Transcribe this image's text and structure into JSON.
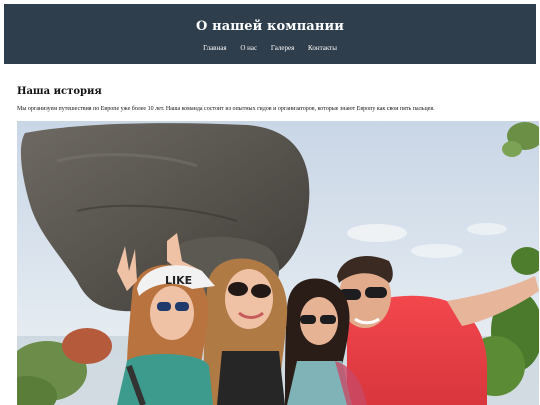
{
  "header": {
    "title": "О нашей компании",
    "nav": [
      {
        "label": "Главная"
      },
      {
        "label": "О нас"
      },
      {
        "label": "Галерея"
      },
      {
        "label": "Контакты"
      }
    ]
  },
  "main": {
    "heading": "Наша история",
    "text": "Мы организуем путешествия по Европе уже более 10 лет. Наша команда состоит из опытных гидов и организаторов, которые знают Европу как свои пять пальцев."
  },
  "photo": {
    "cap_text": "LIKE"
  },
  "colors": {
    "header_bg": "#2f3e4d",
    "header_text": "#ffffff",
    "page_bg": "#ffffff"
  }
}
